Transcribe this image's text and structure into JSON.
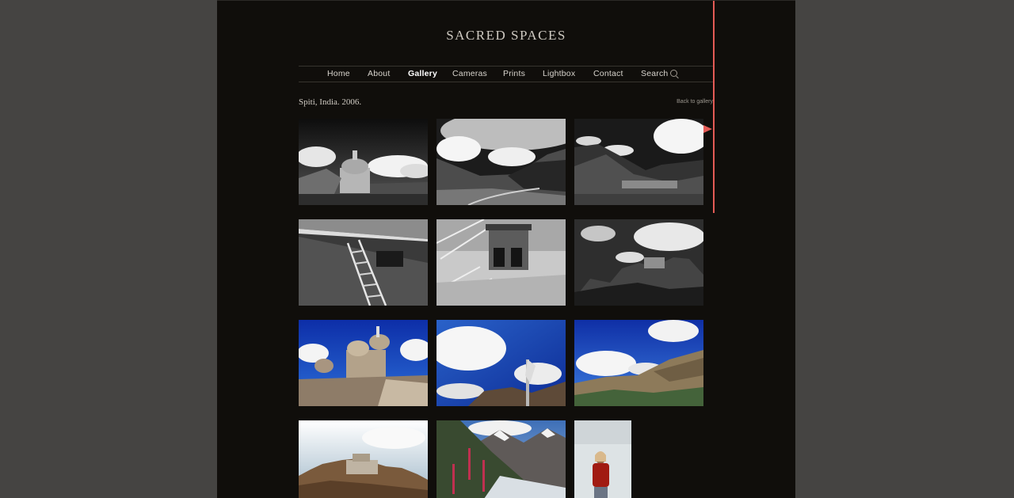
{
  "site": {
    "title": "SACRED SPACES"
  },
  "nav": {
    "items": [
      {
        "label": "Home",
        "active": false
      },
      {
        "label": "About",
        "active": false
      },
      {
        "label": "Gallery",
        "active": true
      },
      {
        "label": "Cameras",
        "active": false
      },
      {
        "label": "Prints",
        "active": false
      },
      {
        "label": "Lightbox",
        "active": false
      },
      {
        "label": "Contact",
        "active": false
      },
      {
        "label": "Search",
        "active": false
      }
    ],
    "search_icon": "search-icon"
  },
  "album": {
    "title": "Spiti, India. 2006.",
    "back_label": "Back to gallery"
  },
  "colors": {
    "page_background": "#454442",
    "content_background": "#100e0b",
    "text": "#cfcac2",
    "annotation_red": "#e45b56"
  },
  "gallery": {
    "thumbnails": [
      {
        "subject": "stupa-bw",
        "style": "black-and-white"
      },
      {
        "subject": "valley-road-bw",
        "style": "black-and-white"
      },
      {
        "subject": "mountain-village-bw",
        "style": "black-and-white"
      },
      {
        "subject": "ladder-wall-bw",
        "style": "black-and-white"
      },
      {
        "subject": "window-wall-bw",
        "style": "black-and-white"
      },
      {
        "subject": "hilltop-monastery-bw",
        "style": "black-and-white"
      },
      {
        "subject": "stupas-blue-sky",
        "style": "color"
      },
      {
        "subject": "prayer-flag-sky",
        "style": "color"
      },
      {
        "subject": "mountain-valley-sky",
        "style": "color"
      },
      {
        "subject": "cliff-monastery",
        "style": "color"
      },
      {
        "subject": "snowy-peaks-flowers",
        "style": "color"
      },
      {
        "subject": "woman-red-jacket",
        "style": "color"
      }
    ]
  }
}
